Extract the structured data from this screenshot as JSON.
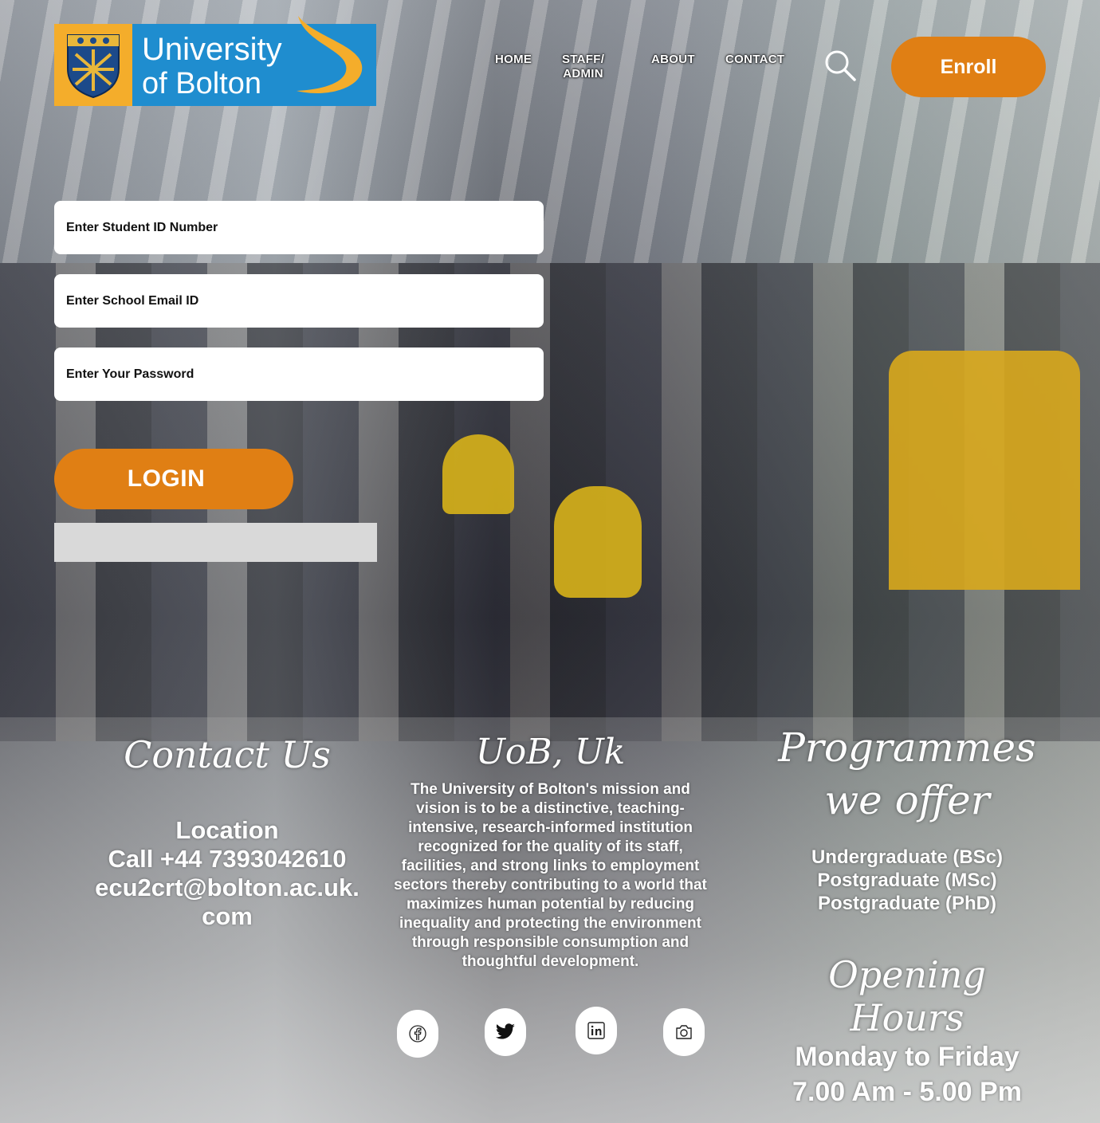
{
  "brand": {
    "logo_line1": "University",
    "logo_line2": "of Bolton",
    "colors": {
      "orange": "#e07f14",
      "logo_blue": "#1f8dcf",
      "logo_gold": "#f4ad2b",
      "field_bg": "#ffffff",
      "bar_gray": "#d9d9d9"
    }
  },
  "nav": {
    "home": "HOME",
    "staff_line1": "STAFF/",
    "staff_line2": "ADMIN",
    "about": "ABOUT",
    "contact": "CONTACT",
    "search_icon": "search-icon",
    "enroll": "Enroll"
  },
  "form": {
    "student_id_placeholder": "Enter Student ID Number",
    "email_placeholder": "Enter School Email ID",
    "password_placeholder": "Enter Your Password",
    "login_label": "LOGIN"
  },
  "contact": {
    "heading": "Contact Us",
    "location": "Location",
    "phone": "Call +44 7393042610",
    "email_line1": "ecu2crt@bolton.ac.uk.",
    "email_line2": "com"
  },
  "about": {
    "heading": "UoB, Uk",
    "text": "The University of Bolton's mission and vision is to be a distinctive, teaching-intensive, research-informed institution recognized for the quality of its staff, facilities, and strong links to employment sectors thereby contributing to a world that maximizes human potential by reducing inequality and protecting the environment through responsible consumption and thoughtful development."
  },
  "socials": [
    "facebook-icon",
    "twitter-icon",
    "linkedin-icon",
    "instagram-icon"
  ],
  "programmes": {
    "heading": "Programmes we offer",
    "items": [
      "Undergraduate (BSc)",
      "Postgraduate (MSc)",
      "Postgraduate (PhD)"
    ]
  },
  "hours": {
    "heading": "Opening Hours",
    "days": "Monday to Friday",
    "time": "7.00 Am - 5.00 Pm"
  }
}
